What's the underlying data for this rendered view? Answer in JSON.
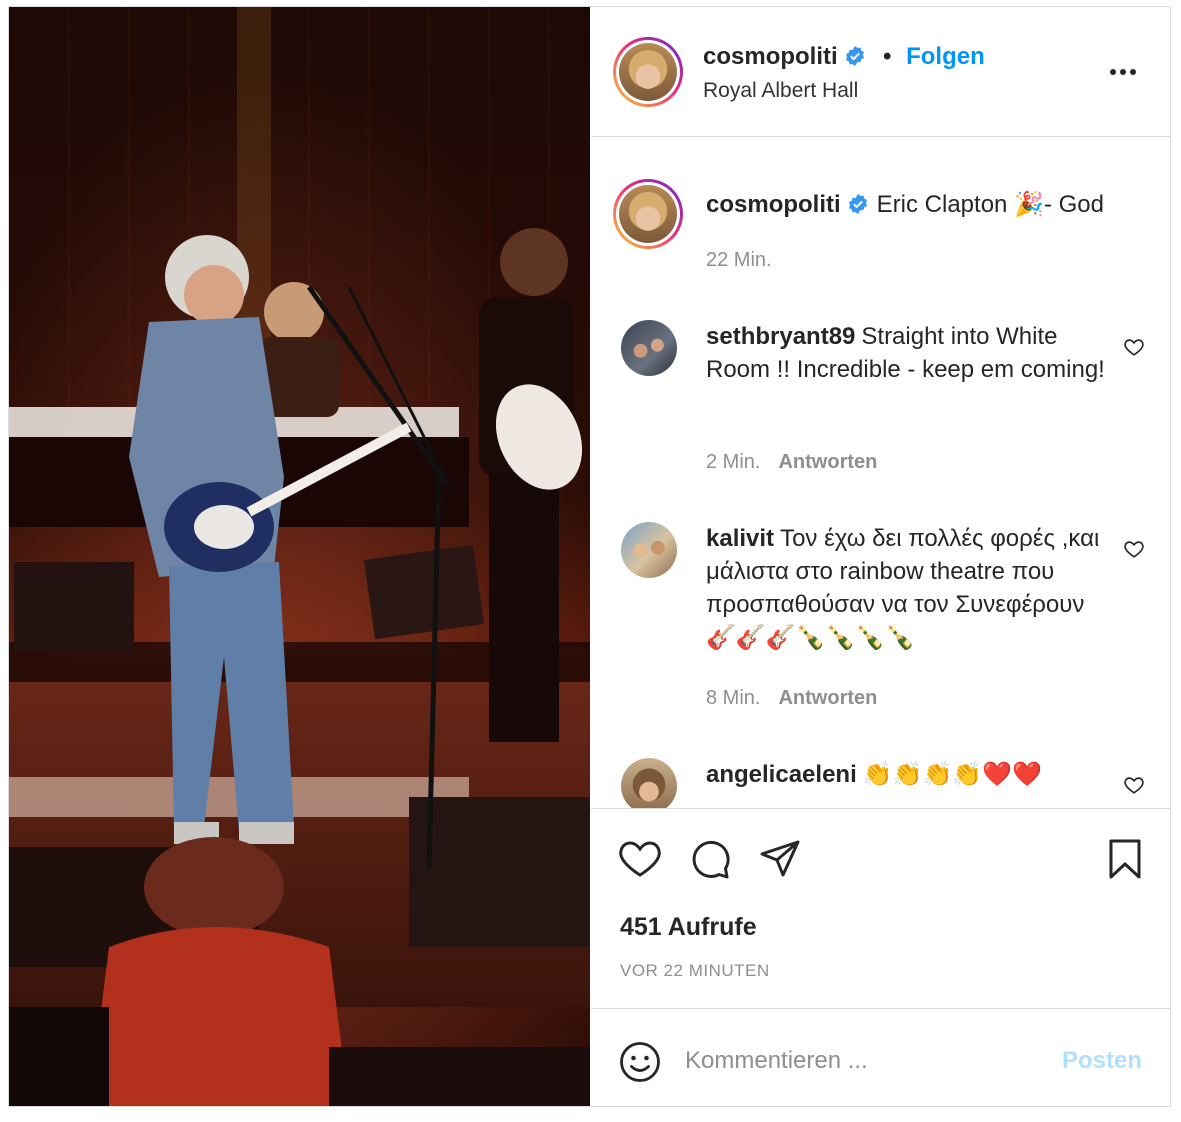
{
  "post": {
    "author": {
      "username": "cosmopoliti",
      "verified": true,
      "follow_label": "Folgen",
      "location": "Royal Albert Hall"
    },
    "menu_icon": "more-horizontal-icon",
    "media": {
      "type": "video-still",
      "description_icon": "concert-photo"
    },
    "caption": {
      "username": "cosmopoliti",
      "text": "Eric Clapton 🎉- God",
      "time": "22 Min."
    },
    "comments": [
      {
        "username": "sethbryant89",
        "text": "Straight into White Room !! Incredible - keep em coming!",
        "time": "2 Min.",
        "reply_label": "Antworten"
      },
      {
        "username": "kalivit",
        "text": "Τον έχω δει πολλές φορές ,και μάλιστα στο rainbow theatre που προσπαθούσαν να τον Συνεφέρουν🎸🎸🎸🍾🍾🍾🍾",
        "time": "8 Min.",
        "reply_label": "Antworten"
      },
      {
        "username": "angelicaeleni",
        "text": "👏👏👏👏❤️❤️"
      }
    ],
    "actions": {
      "icons": [
        "heart-icon",
        "comment-icon",
        "share-icon",
        "bookmark-icon"
      ],
      "views": "451 Aufrufe",
      "time_ago": "VOR 22 MINUTEN"
    },
    "compose": {
      "placeholder": "Kommentieren ...",
      "post_label": "Posten"
    },
    "colors": {
      "accent": "#0095f6",
      "post_disabled": "#b2dffc",
      "muted": "#8e8e8e",
      "text": "#262626"
    }
  }
}
